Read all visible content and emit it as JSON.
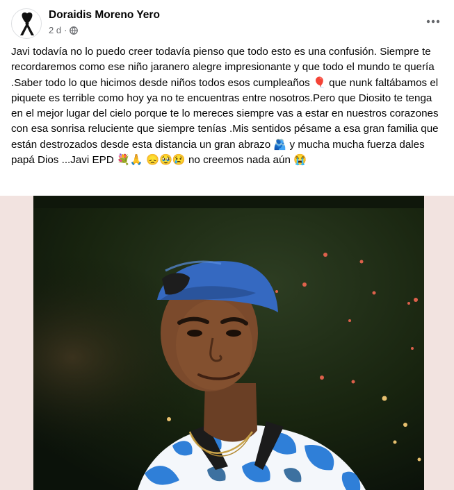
{
  "post": {
    "author": "Doraidis Moreno Yero",
    "time": "2 d",
    "separator": "·",
    "audience_icon": "globe-icon",
    "avatar_icon": "black-mourning-ribbon",
    "menu_icon": "more-dots-icon",
    "text": {
      "p1": "Javi todavía no lo puedo creer todavía pienso que todo esto es una confusión. Siempre te recordaremos como ese niño jaranero alegre impresionante y que todo el mundo te quería .Saber todo lo que hicimos desde niños todos esos cumpleaños",
      "emoji_balloon": "🎈",
      "p2": " que nunk faltábamos el piquete es terrible como hoy ya no te encuentras entre nosotros.Pero que Diosito te tenga en el mejor lugar del cielo porque te lo mereces siempre vas a estar en nuestros corazones con esa sonrisa reluciente que siempre tenías .Mis sentidos pésame a esa gran familia que están destrozados desde esta distancia un gran abrazo ",
      "emoji_hug": "🫂",
      "p3": " y mucha mucha fuerza dales papá Dios ...Javi EPD ",
      "emoji_flowers": "💐",
      "emoji_pray": "🙏",
      "emoji_faces": "😞🥹😢",
      "p4": " no creemos nada aún ",
      "emoji_cry": "😭"
    },
    "photo": {
      "description_icon": "young-man-portrait-photo"
    }
  },
  "colors": {
    "text": "#050505",
    "secondary": "#65676b",
    "photo_backdrop": "#f2e3e0",
    "cap_blue": "#3a6fc7"
  }
}
